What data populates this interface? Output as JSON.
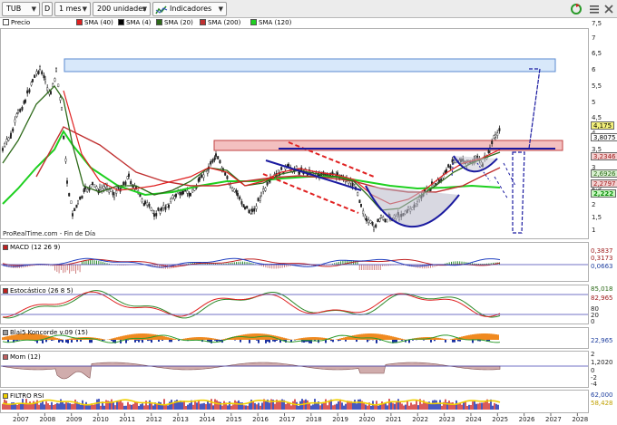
{
  "toolbar": {
    "ticker": "TUB",
    "period_label": "D",
    "timeframe": "1 mes",
    "units": "200 unidades",
    "indicators_label": "Indicadores"
  },
  "legend": {
    "price": "Precio",
    "sma40": "SMA (40)",
    "sma4": "SMA (4)",
    "sma20": "SMA (20)",
    "sma200": "SMA (200)",
    "sma120": "SMA (120)"
  },
  "colors": {
    "price": "#ffffff",
    "sma40": "#e02020",
    "sma4": "#000000",
    "sma20": "#2e6a1a",
    "sma200": "#c03030",
    "sma120": "#1ed020",
    "trend_blue": "#1a1aa0",
    "trend_red": "#e02020"
  },
  "source_label": "ProRealTime.com - Fin de Día",
  "x_axis": {
    "years": [
      "2007",
      "2008",
      "2009",
      "2010",
      "2011",
      "2012",
      "2013",
      "2014",
      "2015",
      "2016",
      "2017",
      "2018",
      "2019",
      "2020",
      "2021",
      "2022",
      "2023",
      "2024",
      "2025",
      "2026",
      "2027",
      "2028"
    ]
  },
  "price_axis": {
    "ticks": [
      "7,5",
      "7",
      "6,5",
      "6",
      "5,5",
      "5",
      "4,5",
      "4",
      "3,5",
      "3",
      "2,5",
      "2",
      "1,5",
      "1"
    ]
  },
  "price_badges": {
    "last": "4,175",
    "sma4": "3,8075",
    "sma40": "3,2346",
    "sma20": "2,6926",
    "sma200": "2,2797",
    "sma120": "2,222"
  },
  "panels": {
    "macd": {
      "label": "MACD (12 26 9)",
      "values": [
        "0,3837",
        "0,3173",
        "0,0663"
      ]
    },
    "stoch": {
      "label": "Estocástico (26 8 5)",
      "values": [
        "85,018",
        "82,965"
      ]
    },
    "blai5": {
      "label": "Blai5 Koncorde v.09 (15)",
      "values": [
        "22,965"
      ]
    },
    "mom": {
      "label": "Mom (12)",
      "values": [
        "1,2020"
      ]
    },
    "filtro": {
      "label": "FILTRO RSI",
      "values": [
        "62,000",
        "58,428"
      ]
    }
  },
  "side_axis": {
    "stoch_ticks": [
      "80",
      "20",
      "0"
    ],
    "mom_ticks": [
      "2",
      "0",
      "-2",
      "-4"
    ]
  }
}
